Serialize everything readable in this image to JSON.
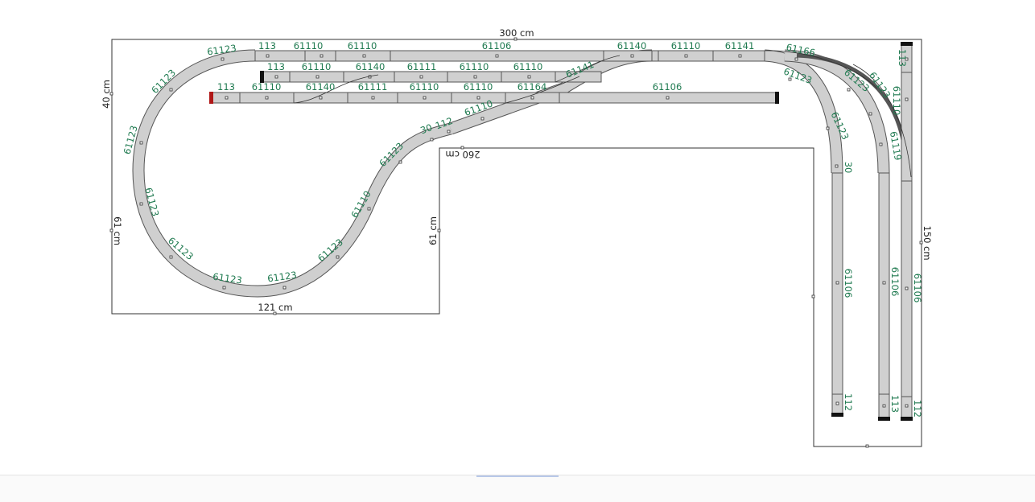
{
  "dimensions": {
    "top": "300 cm",
    "left": "40 cm",
    "inner_top": "260 cm",
    "left_lower": "61 cm",
    "inner_right": "61 cm",
    "bottom_left": "121 cm",
    "right": "150 cm"
  },
  "track_labels": {
    "t1": "61123",
    "t2": "113",
    "t3": "61110",
    "t4": "61110",
    "t5": "61106",
    "t6": "61140",
    "t7": "61110",
    "t8": "61141",
    "t9": "61166",
    "t10": "113",
    "t11": "61110",
    "t12": "61140",
    "t13": "61111",
    "t14": "61110",
    "t15": "61110",
    "t16": "61141",
    "t17": "113",
    "t18": "61110",
    "t19": "61140",
    "t20": "61111",
    "t21": "61110",
    "t22": "61110",
    "t23": "61164",
    "t24": "61106",
    "t25": "61123",
    "t26": "61123",
    "t27": "61123",
    "t28": "61123",
    "t29": "61123",
    "t30": "61123",
    "t31": "61123",
    "t32": "61123",
    "t33": "61123",
    "t34": "61110",
    "t35": "61123",
    "t36": "30",
    "t37": "112",
    "t38": "61110",
    "t39": "61123",
    "t40": "61123",
    "t41": "30",
    "t42": "61106",
    "t43": "112",
    "t44": "61123",
    "t45": "61123",
    "t46": "61106",
    "t47": "113",
    "t48": "113",
    "t49": "61110",
    "t50": "61119",
    "t51": "61106",
    "t52": "112"
  }
}
